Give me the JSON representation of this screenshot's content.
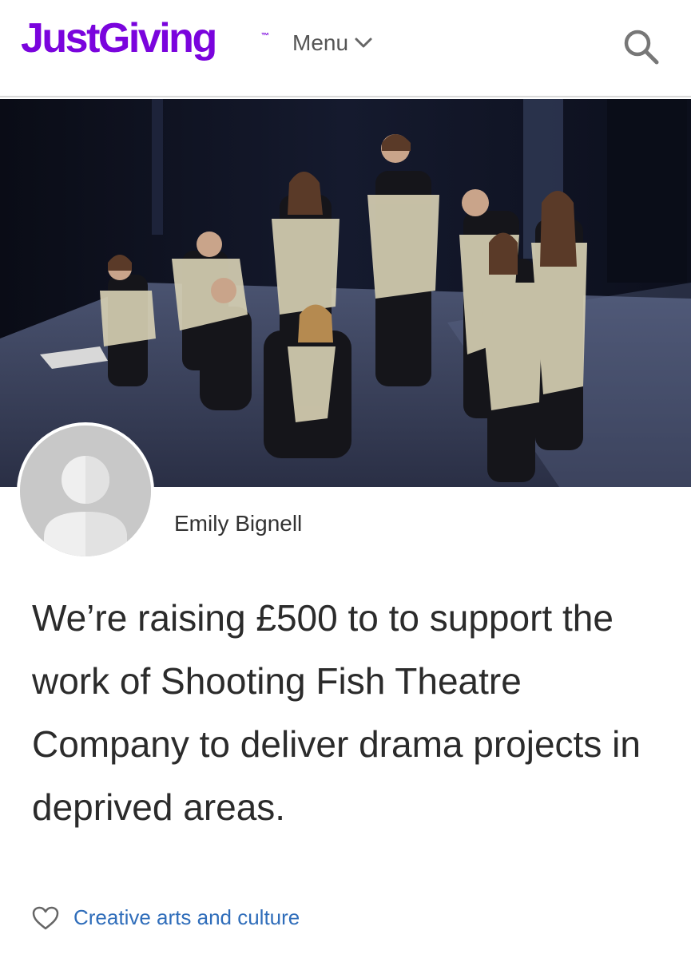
{
  "header": {
    "logo_text": "JustGiving",
    "logo_mark": "™",
    "menu_label": "Menu",
    "menu_icon": "chevron-down-icon",
    "search_icon": "search-icon",
    "brand_color": "#7a04dd"
  },
  "hero": {
    "image_description_icon": "hero-photo"
  },
  "profile": {
    "owner_name": "Emily Bignell",
    "avatar_icon": "default-avatar-icon"
  },
  "page": {
    "headline": "We’re raising £500 to to support the work of Shooting Fish Theatre Company to deliver drama projects in deprived areas."
  },
  "category": {
    "icon": "heart-icon",
    "label": "Creative arts and culture",
    "link_color": "#2f6dba"
  }
}
